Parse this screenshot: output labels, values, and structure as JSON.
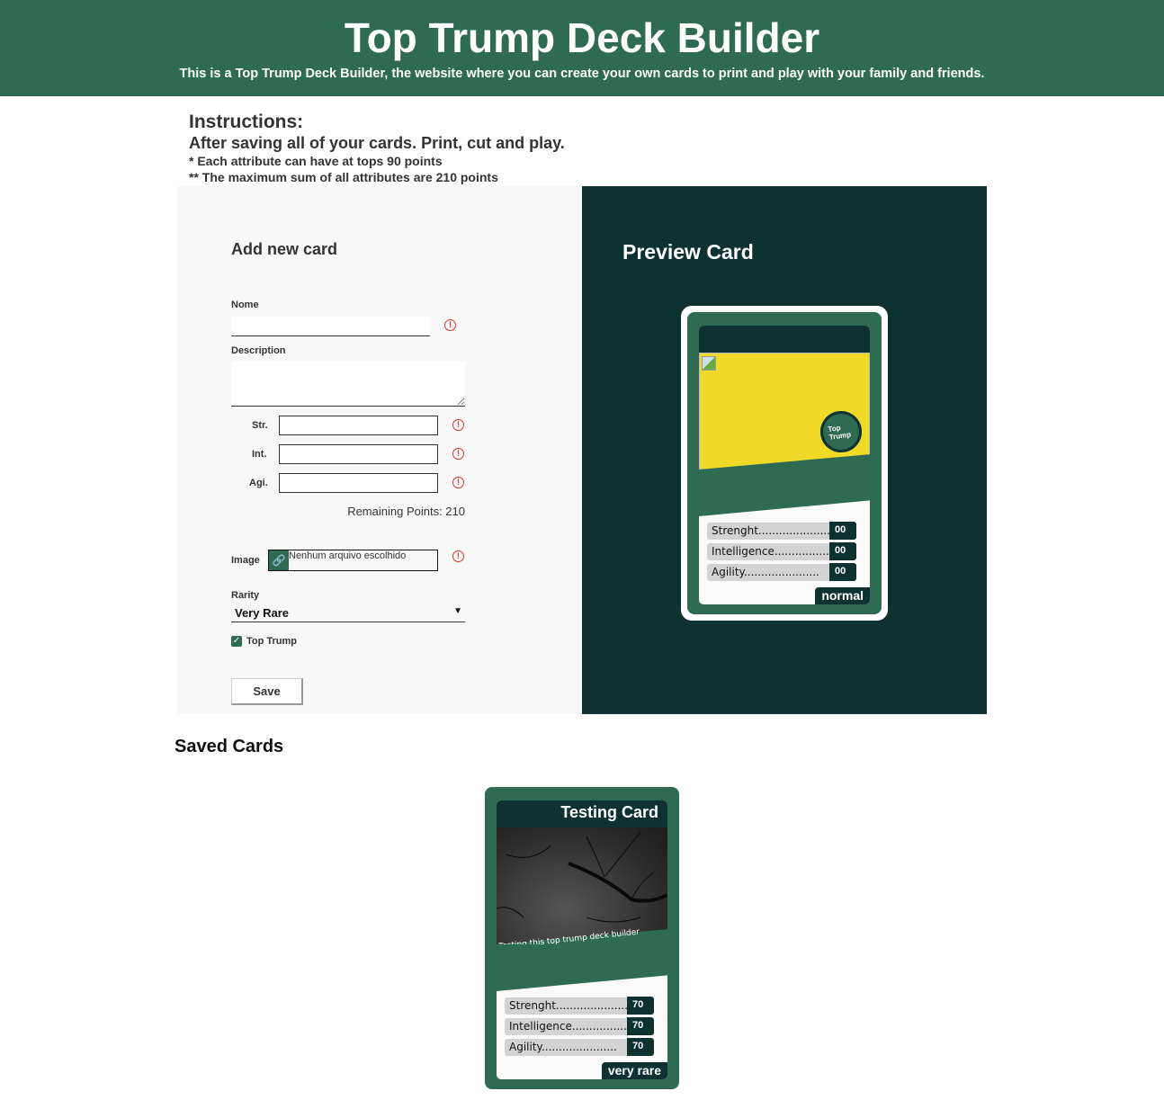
{
  "header": {
    "title": "Top Trump Deck Builder",
    "subtitle": "This is a Top Trump Deck Builder, the website where you can create your own cards to print and play with your family and friends."
  },
  "instructions": {
    "title": "Instructions:",
    "line1": "After saving all of your cards. Print, cut and play.",
    "line2": "* Each attribute can have at tops 90 points",
    "line3": "** The maximum sum of all attributes are 210 points"
  },
  "form": {
    "title": "Add new card",
    "name_label": "Nome",
    "name_value": "",
    "description_label": "Description",
    "description_value": "",
    "str_label": "Str.",
    "int_label": "Int.",
    "agi_label": "Agi.",
    "remaining": "Remaining Points: 210",
    "image_label": "Image",
    "file_status": "Nenhum arquivo escolhido",
    "rarity_label": "Rarity",
    "rarity_value": "Very Rare",
    "top_trump_label": "Top Trump",
    "top_trump_checked": true,
    "save_label": "Save"
  },
  "preview": {
    "title": "Preview Card",
    "badge": "Top Trump",
    "stats": [
      {
        "label": "Strenght",
        "value": "00"
      },
      {
        "label": "Intelligence",
        "value": "00"
      },
      {
        "label": "Agility",
        "value": "00"
      }
    ],
    "rarity": "normal"
  },
  "saved": {
    "title": "Saved Cards",
    "cards": [
      {
        "name": "Testing Card",
        "description": "Testing this top trump deck builder",
        "stats": [
          {
            "label": "Strenght",
            "value": "70"
          },
          {
            "label": "Intelligence",
            "value": "70"
          },
          {
            "label": "Agility",
            "value": "70"
          }
        ],
        "rarity": "very rare"
      }
    ]
  },
  "colors": {
    "brand": "#2e6b52",
    "dark": "#0e3232",
    "yellow": "#f0d929",
    "error": "#d9342b"
  }
}
